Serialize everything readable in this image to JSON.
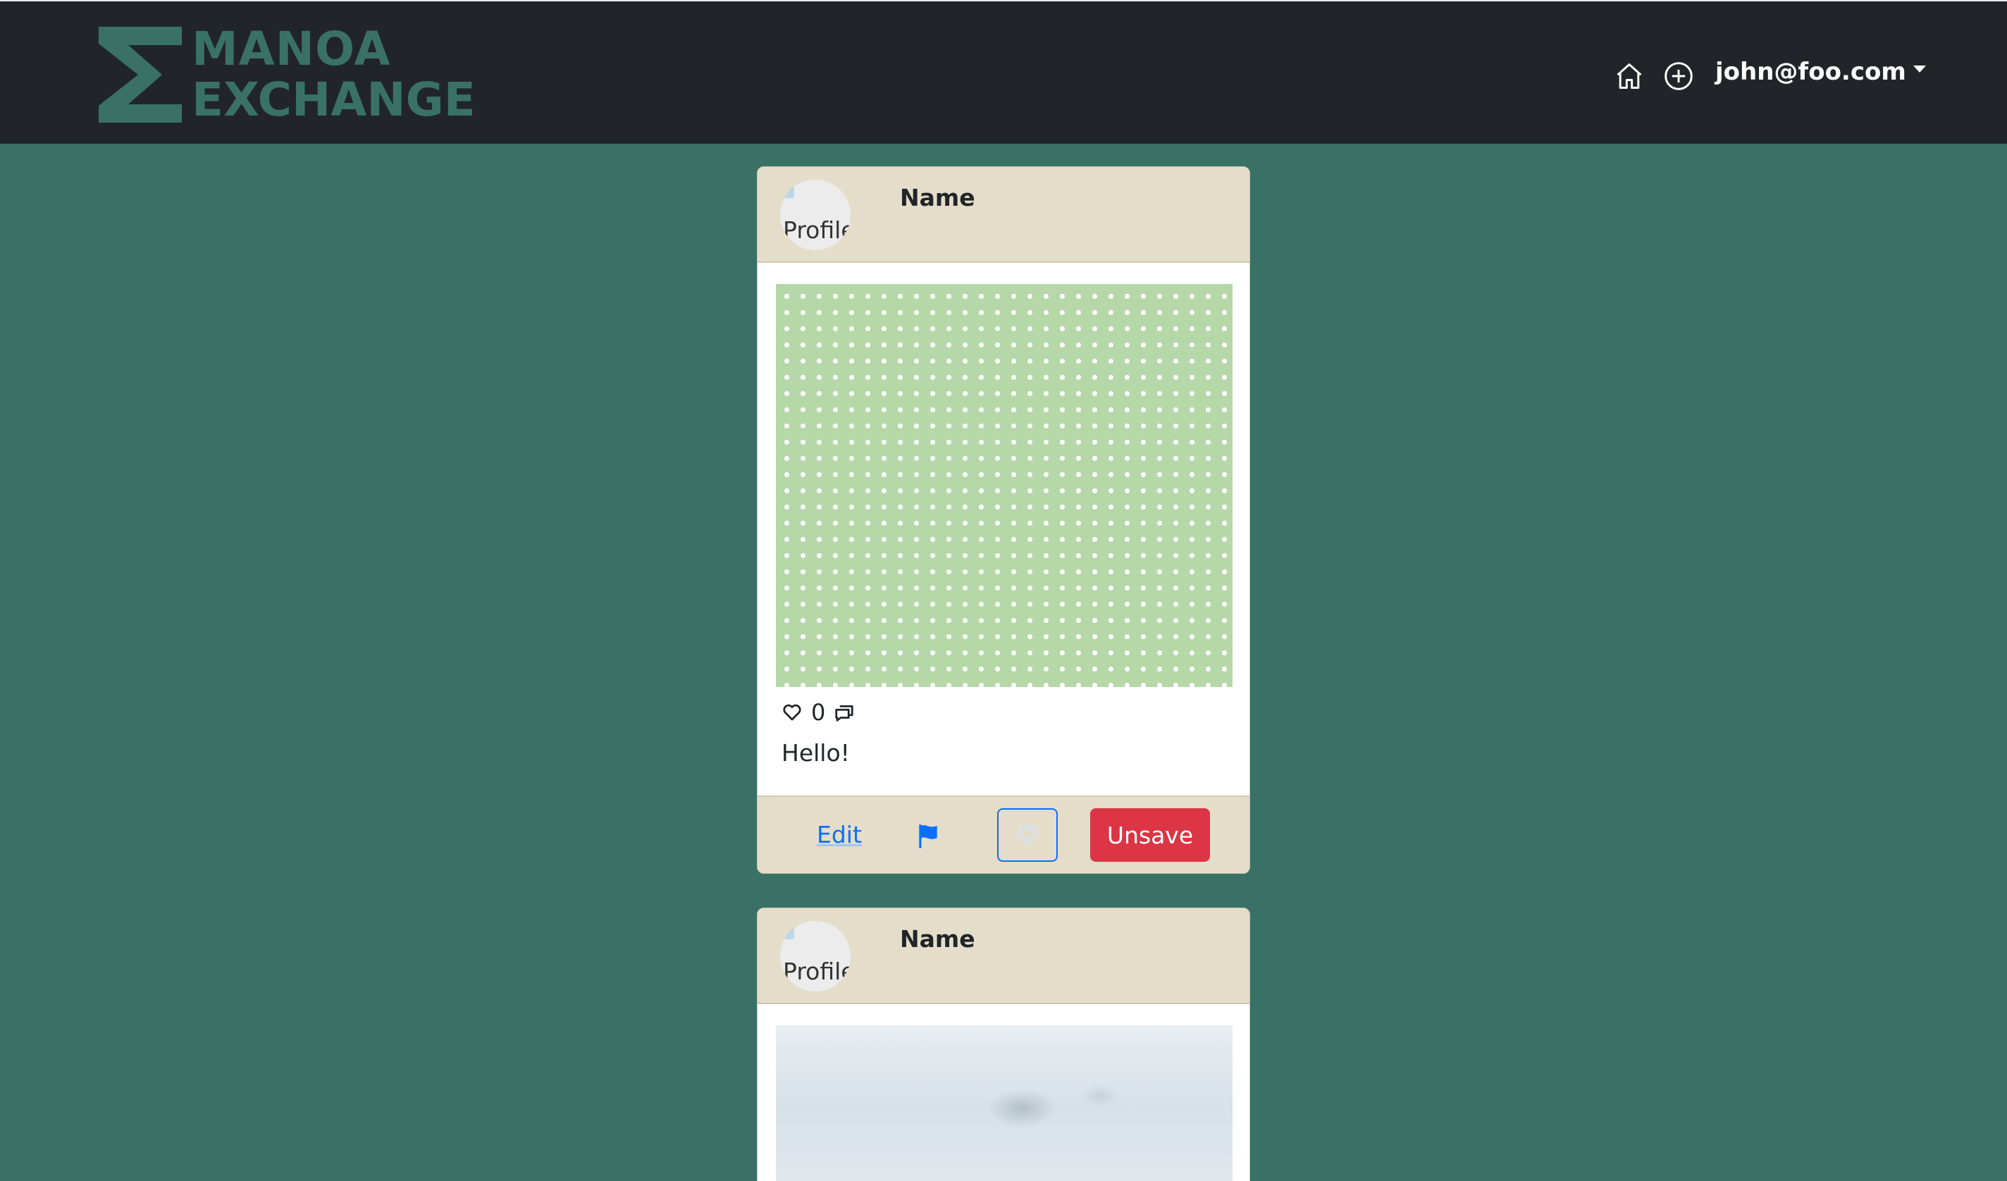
{
  "navbar": {
    "logo_line1": "MANOA",
    "logo_line2": "EXCHANGE",
    "icons": [
      "home-icon",
      "plus-circle-icon"
    ],
    "user_email": "john@foo.com"
  },
  "posts": [
    {
      "name": "Name",
      "avatar_alt": "Profile",
      "likes": "0",
      "caption": "Hello!",
      "edit_label": "Edit",
      "unsave_label": "Unsave"
    },
    {
      "name": "Name",
      "avatar_alt": "Profile"
    }
  ],
  "colors": {
    "background": "#3a7167",
    "navbar": "#212529",
    "card_header": "#e4ddc9",
    "danger": "#dc3545",
    "primary": "#0d6efd"
  }
}
